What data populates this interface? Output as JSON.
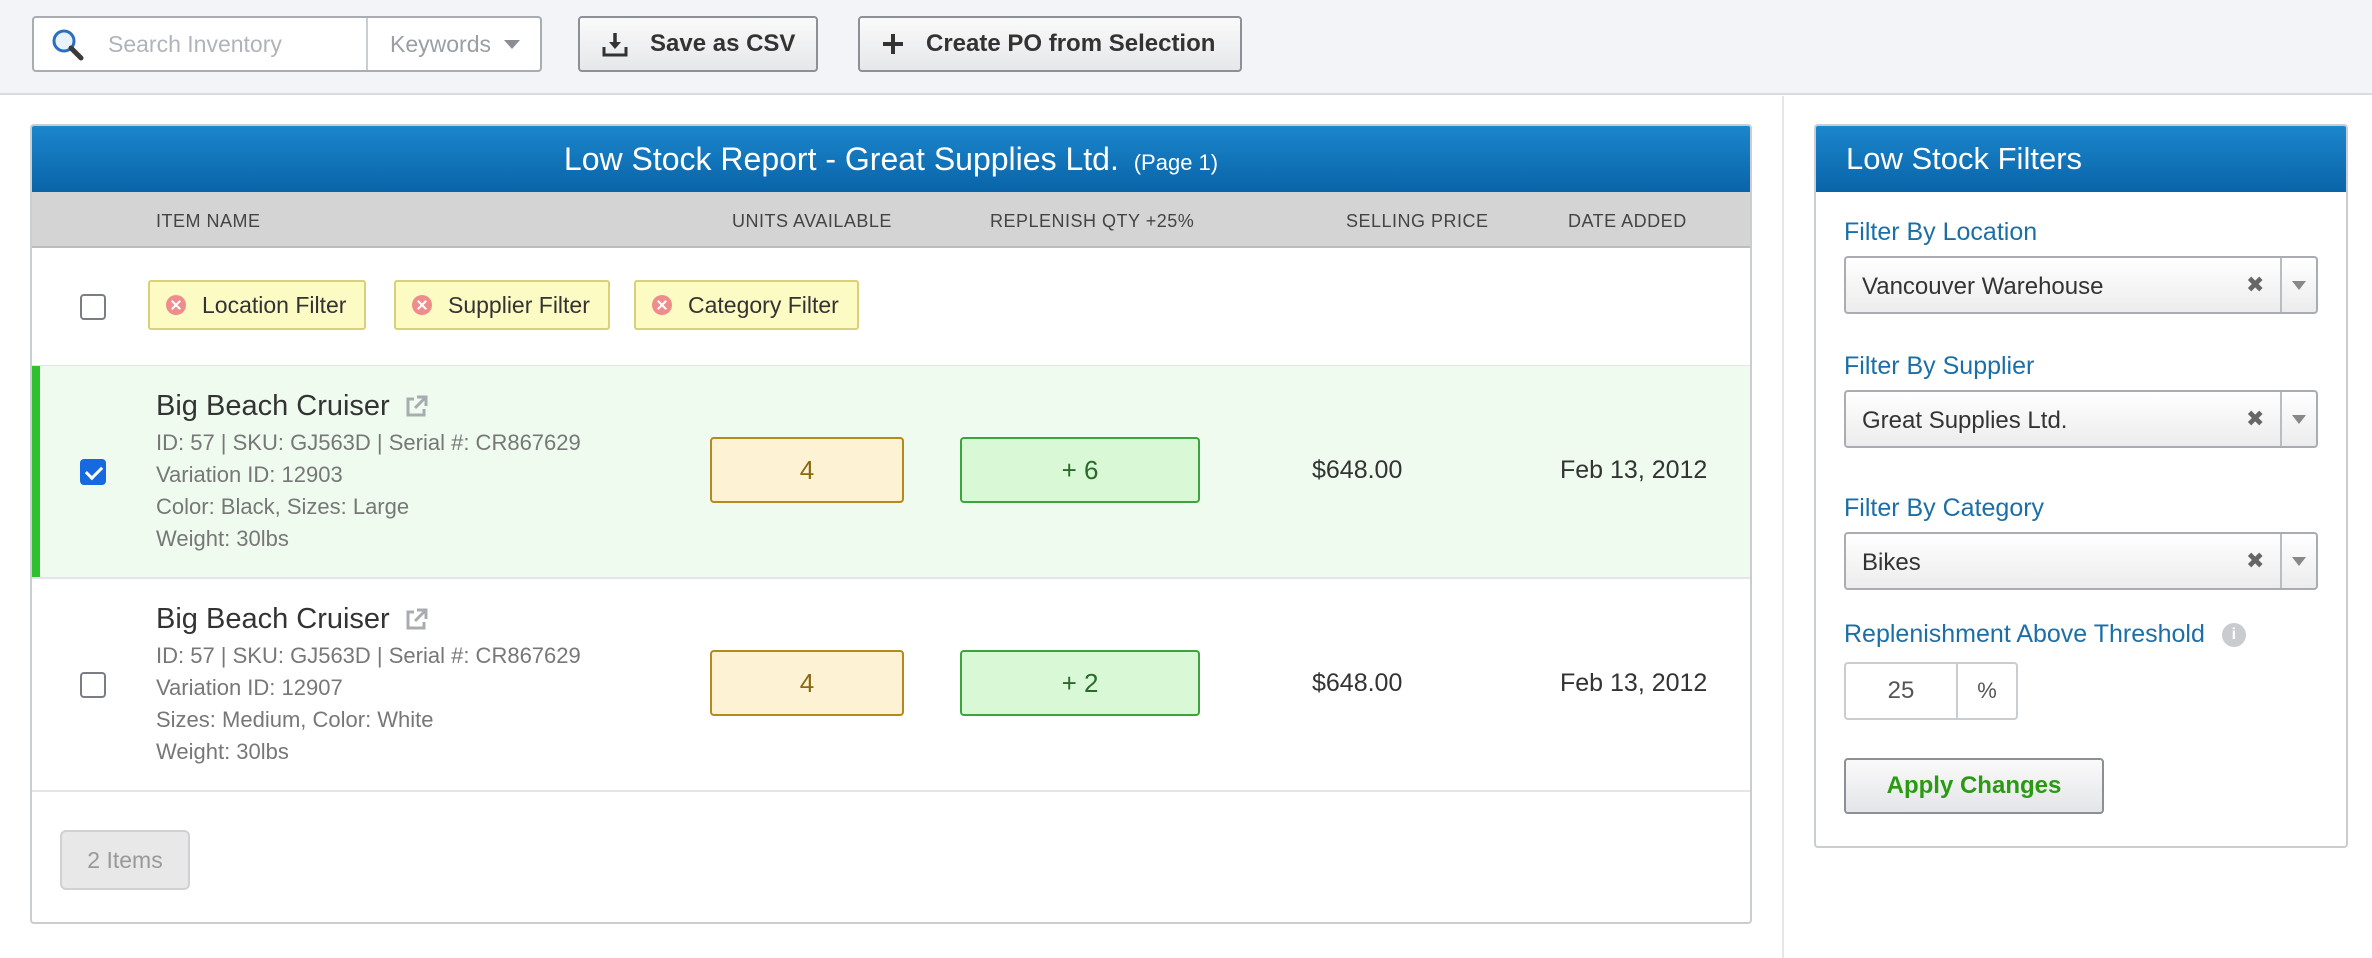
{
  "toolbar": {
    "search_placeholder": "Search Inventory",
    "search_mode": "Keywords",
    "save_csv_label": "Save as CSV",
    "create_po_label": "Create PO from Selection"
  },
  "report": {
    "title": "Low Stock Report - Great Supplies Ltd.",
    "page_label": "(Page 1)",
    "columns": {
      "item_name": "ITEM NAME",
      "units_available": "UNITS AVAILABLE",
      "replenish_qty": "REPLENISH QTY +25%",
      "selling_price": "SELLING PRICE",
      "date_added": "DATE ADDED"
    },
    "filter_chips": [
      "Location Filter",
      "Supplier Filter",
      "Category Filter"
    ],
    "items": [
      {
        "name": "Big Beach Cruiser",
        "ids": "ID: 57 | SKU: GJ563D | Serial #: CR867629",
        "variation": "Variation ID: 12903",
        "attributes": "Color: Black, Sizes: Large",
        "weight": "Weight: 30lbs",
        "units": "4",
        "replenish": "+ 6",
        "price": "$648.00",
        "date": "Feb 13, 2012",
        "selected": true
      },
      {
        "name": "Big Beach Cruiser",
        "ids": "ID: 57 | SKU: GJ563D | Serial #: CR867629",
        "variation": "Variation ID: 12907",
        "attributes": "Sizes: Medium, Color: White",
        "weight": "Weight: 30lbs",
        "units": "4",
        "replenish": "+ 2",
        "price": "$648.00",
        "date": "Feb 13, 2012",
        "selected": false
      }
    ],
    "items_count": "2 Items"
  },
  "filters": {
    "title": "Low Stock Filters",
    "location_label": "Filter By Location",
    "location_value": "Vancouver Warehouse",
    "supplier_label": "Filter By Supplier",
    "supplier_value": "Great Supplies Ltd.",
    "category_label": "Filter By Category",
    "category_value": "Bikes",
    "threshold_label": "Replenishment Above Threshold",
    "threshold_value": "25",
    "threshold_unit": "%",
    "apply_label": "Apply Changes"
  },
  "colors": {
    "header_blue": "#0a64a8",
    "link_blue": "#1c6fa6",
    "selected_bar": "#2fc02f",
    "apply_green": "#2a9a12"
  }
}
